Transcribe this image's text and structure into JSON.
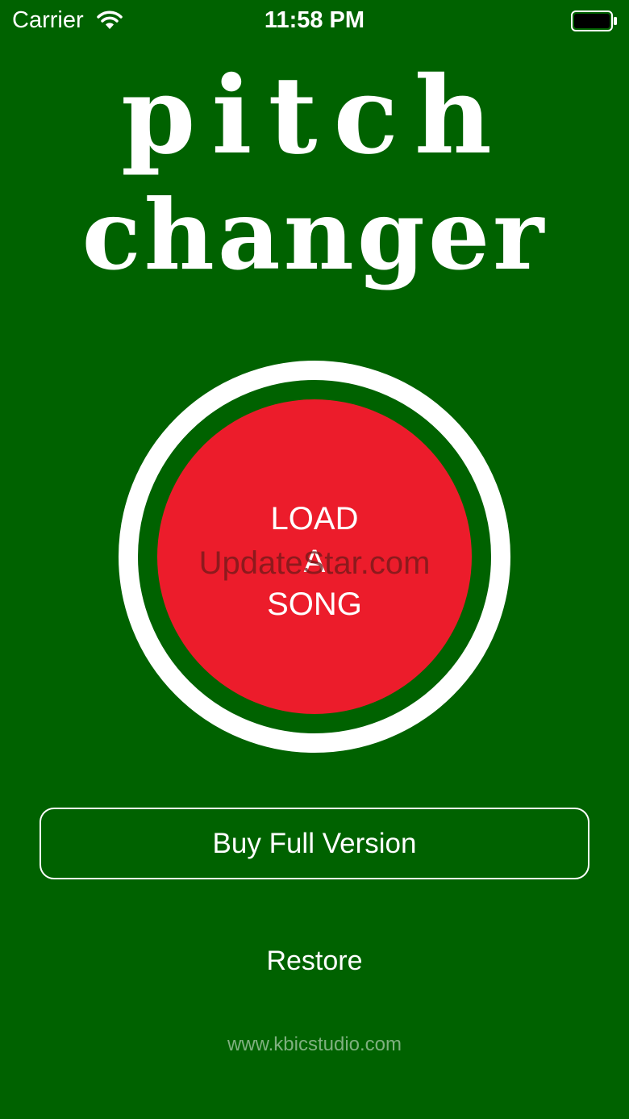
{
  "status_bar": {
    "carrier": "Carrier",
    "time": "11:58 PM"
  },
  "title": {
    "line1": "pitch",
    "line2": "changer"
  },
  "load_button": {
    "label": "LOAD\nA\nSONG"
  },
  "watermark": "UpdateStar.com",
  "buy_button": {
    "label": "Buy Full Version"
  },
  "restore": {
    "label": "Restore"
  },
  "footer": {
    "website": "www.kbicstudio.com"
  },
  "colors": {
    "background": "#006200",
    "button_red": "#ec1c2b",
    "ring": "#ffffff",
    "text": "#ffffff"
  },
  "icons": {
    "wifi": "wifi-icon",
    "battery": "battery-icon"
  }
}
